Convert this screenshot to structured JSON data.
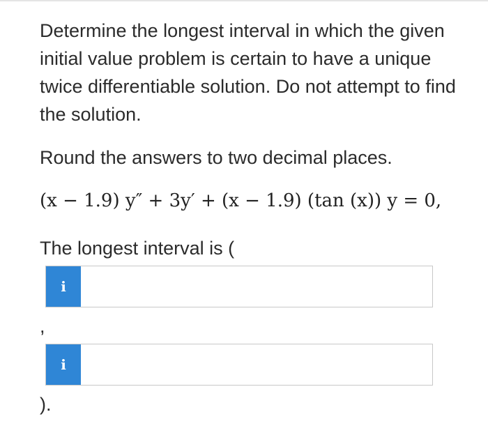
{
  "question": {
    "text": "Determine the longest interval in which the given initial value problem is certain to have a unique twice differentiable solution. Do not attempt to find the solution.",
    "instruction": "Round the answers to two decimal places.",
    "equation": "(x − 1.9) y″ + 3y′ + (x − 1.9) (tan (x)) y = 0,"
  },
  "answer": {
    "lead": "The longest interval is (",
    "separator": ",",
    "closing": ").",
    "fields": [
      {
        "badge": "i",
        "value": "",
        "placeholder": ""
      },
      {
        "badge": "i",
        "value": "",
        "placeholder": ""
      }
    ]
  },
  "colors": {
    "badge": "#2f86d6",
    "text": "#2b2b2b",
    "border": "#c8c8c8"
  }
}
